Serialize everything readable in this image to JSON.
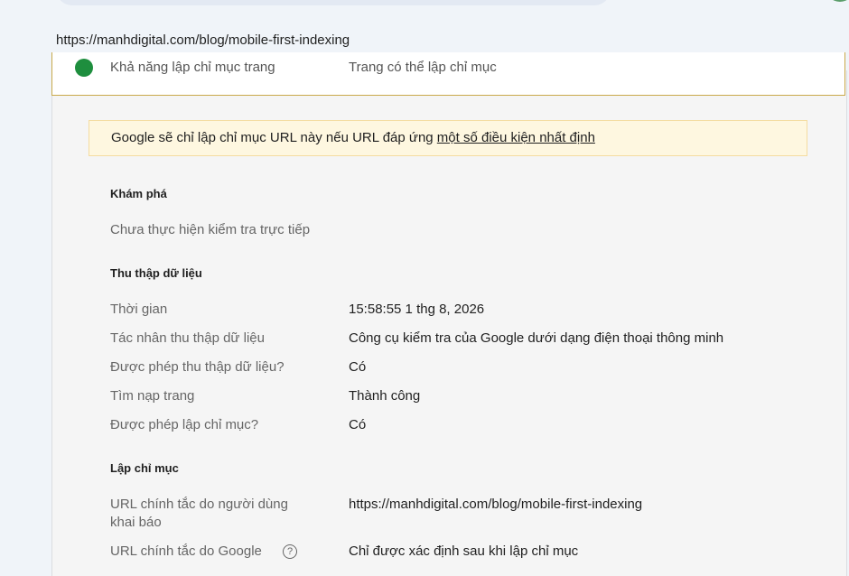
{
  "page_url": "https://manhdigital.com/blog/mobile-first-indexing",
  "top_row": {
    "label": "Khả năng lập chỉ mục trang",
    "value": "Trang có thể lập chỉ mục"
  },
  "notice": {
    "text": "Google sẽ chỉ lập chỉ mục URL này nếu URL đáp ứng ",
    "link": "một số điều kiện nhất định"
  },
  "discovery": {
    "title": "Khám phá",
    "message": "Chưa thực hiện kiểm tra trực tiếp"
  },
  "crawl": {
    "title": "Thu thập dữ liệu",
    "rows": [
      {
        "label": "Thời gian",
        "value": "15:58:55 1 thg 8, 2026"
      },
      {
        "label": "Tác nhân thu thập dữ liệu",
        "value": "Công cụ kiểm tra của Google dưới dạng điện thoại thông minh"
      },
      {
        "label": "Được phép thu thập dữ liệu?",
        "value": "Có"
      },
      {
        "label": "Tìm nạp trang",
        "value": "Thành công"
      },
      {
        "label": "Được phép lập chỉ mục?",
        "value": "Có"
      }
    ]
  },
  "indexing": {
    "title": "Lập chỉ mục",
    "rows": [
      {
        "label": "URL chính tắc do người dùng khai báo",
        "value": "https://manhdigital.com/blog/mobile-first-indexing"
      },
      {
        "label": "URL chính tắc do Google",
        "value": "Chỉ được xác định sau khi lập chỉ mục"
      }
    ]
  },
  "icons": {
    "check": "check-circle-icon",
    "help": "help-circle-icon"
  },
  "colors": {
    "success": "#1e8e3e",
    "notice_bg": "#fef7e0",
    "highlight_border": "#c8a94a"
  }
}
